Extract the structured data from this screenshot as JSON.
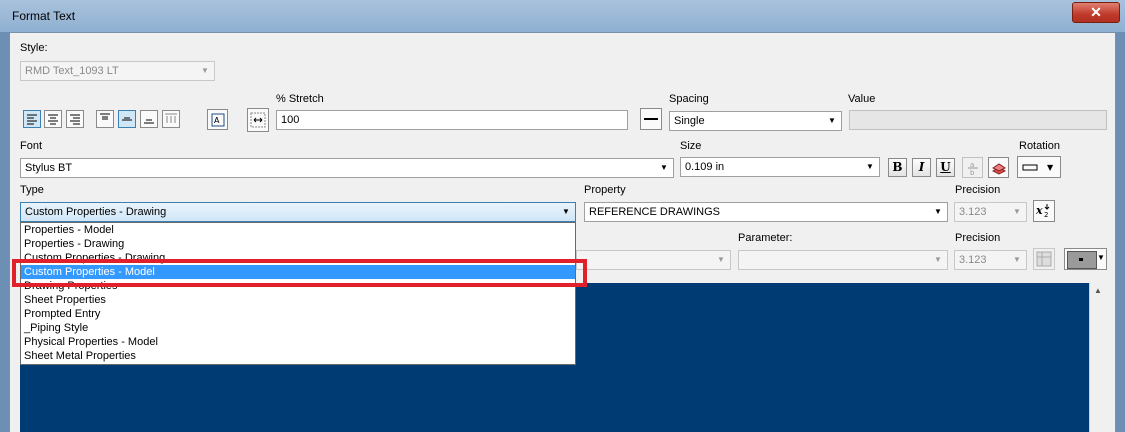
{
  "window": {
    "title": "Format Text",
    "close_glyph": "✕"
  },
  "style": {
    "label": "Style:",
    "value": "RMD Text_1093 LT"
  },
  "stretch": {
    "label": "% Stretch",
    "value": "100"
  },
  "spacing": {
    "label": "Spacing",
    "value": "Single"
  },
  "value_field": {
    "label": "Value",
    "value": ""
  },
  "font": {
    "label": "Font",
    "value": "Stylus BT"
  },
  "size": {
    "label": "Size",
    "value": "0.109 in"
  },
  "format_buttons": {
    "bold": "B",
    "italic": "I",
    "underline": "U"
  },
  "rotation": {
    "label": "Rotation"
  },
  "type": {
    "label": "Type",
    "value": "Custom Properties - Drawing",
    "options": [
      "Properties - Model",
      "Properties - Drawing",
      "Custom Properties - Drawing",
      "Custom Properties - Model",
      "Drawing Properties",
      "Sheet Properties",
      "Prompted Entry",
      "_Piping Style",
      "Physical Properties - Model",
      "Sheet Metal Properties"
    ],
    "selected_index": 3
  },
  "property": {
    "label": "Property",
    "value": "REFERENCE DRAWINGS"
  },
  "precision1": {
    "label": "Precision",
    "value": "3.123"
  },
  "parameter": {
    "label": "Parameter:",
    "value": ""
  },
  "precision2": {
    "label": "Precision",
    "value": "3.123"
  },
  "colors": {
    "preview_bg": "#003b73",
    "selection": "#3399ff",
    "highlight": "#e0202a",
    "titlebar": "#a9c2dc"
  }
}
